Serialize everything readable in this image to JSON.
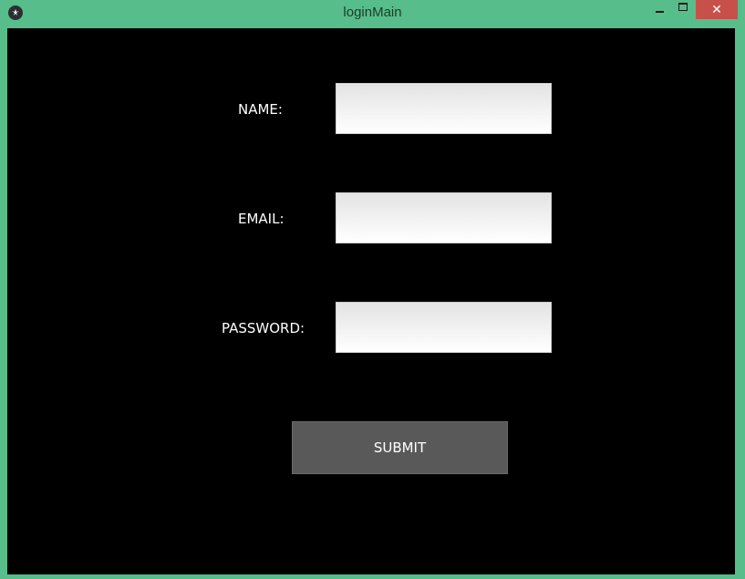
{
  "window": {
    "title": "loginMain",
    "app_icon": "kivy-logo-icon",
    "close_glyph": "✕"
  },
  "form": {
    "name_label": "NAME:",
    "name_value": "",
    "email_label": "EMAIL:",
    "email_value": "",
    "password_label": "PASSWORD:",
    "password_value": "",
    "submit_label": "SUBMIT"
  },
  "colors": {
    "frame": "#57bd8a",
    "background": "#000000",
    "button": "#595959",
    "close_button": "#c7504b"
  }
}
